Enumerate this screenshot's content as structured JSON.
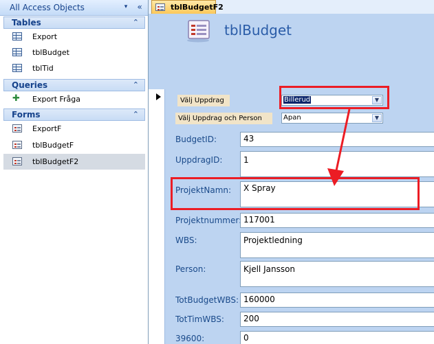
{
  "nav": {
    "title": "All Access Objects",
    "dropdown_glyph": "▾",
    "collapse_glyph": "«",
    "groups": [
      {
        "label": "Tables",
        "chevron": "⌃",
        "items": [
          {
            "label": "Export",
            "icon": "table-icon"
          },
          {
            "label": "tblBudget",
            "icon": "table-icon"
          },
          {
            "label": "tblTid",
            "icon": "table-icon"
          }
        ]
      },
      {
        "label": "Queries",
        "chevron": "⌃",
        "items": [
          {
            "label": "Export Fråga",
            "icon": "append-query-icon"
          }
        ]
      },
      {
        "label": "Forms",
        "chevron": "⌃",
        "items": [
          {
            "label": "ExportF",
            "icon": "form-icon"
          },
          {
            "label": "tblBudgetF",
            "icon": "form-icon"
          },
          {
            "label": "tblBudgetF2",
            "icon": "form-icon",
            "selected": true
          }
        ]
      }
    ]
  },
  "document": {
    "tab_label": "tblBudgetF2",
    "form_title": "tblBudget",
    "combos": {
      "uppdrag": {
        "label": "Välj Uppdrag",
        "value": "Billerud"
      },
      "uppdrag_person": {
        "label": "Välj Uppdrag och Person",
        "value": "Apan"
      }
    },
    "fields": {
      "budget_id": {
        "label": "BudgetID:",
        "value": "43"
      },
      "uppdrag_id": {
        "label": "UppdragID:",
        "value": "1"
      },
      "projekt_namn": {
        "label": "ProjektNamn:",
        "value": "X Spray"
      },
      "projektnummer": {
        "label": "Projektnummer:",
        "value": "117001"
      },
      "wbs": {
        "label": "WBS:",
        "value": "Projektledning"
      },
      "person": {
        "label": "Person:",
        "value": "Kjell Jansson"
      },
      "tot_budget_wbs": {
        "label": "TotBudgetWBS:",
        "value": "160000"
      },
      "tot_tim_wbs": {
        "label": "TotTimWBS:",
        "value": "200"
      },
      "f39600": {
        "label": "39600:",
        "value": "0"
      }
    }
  },
  "colors": {
    "annotation_red": "#ec1c24",
    "form_background": "#bdd4f1",
    "label_blue": "#1a4a8a",
    "title_blue": "#2a5ca8"
  }
}
